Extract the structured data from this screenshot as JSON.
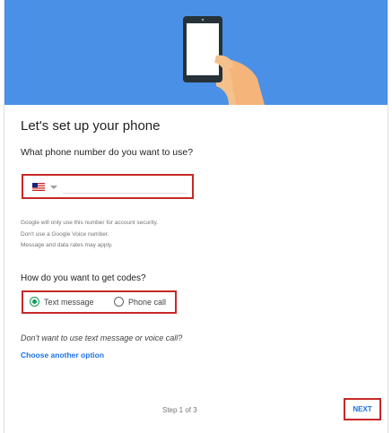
{
  "header": {
    "illustration": "hand-holding-phone-illustration",
    "background_color": "#4a90e6"
  },
  "main": {
    "title": "Let's set up your phone",
    "phone_question": "What phone number do you want to use?",
    "phone_field": {
      "country_flag": "us-flag-icon",
      "value": "",
      "placeholder": ""
    },
    "info_lines": [
      "Google will only use this number for account security.",
      "Don't use a Google Voice number.",
      "Message and data rates may apply."
    ],
    "codes_question": "How do you want to get codes?",
    "code_options": [
      {
        "label": "Text message",
        "selected": true
      },
      {
        "label": "Phone call",
        "selected": false
      }
    ],
    "alt_question": "Don't want to use text message or voice call?",
    "alt_link": "Choose another option"
  },
  "footer": {
    "step": "Step 1 of 3",
    "next_label": "NEXT"
  },
  "colors": {
    "accent": "#1a73e8",
    "selected_radio": "#0f9d58",
    "highlight_border": "#c62828"
  }
}
